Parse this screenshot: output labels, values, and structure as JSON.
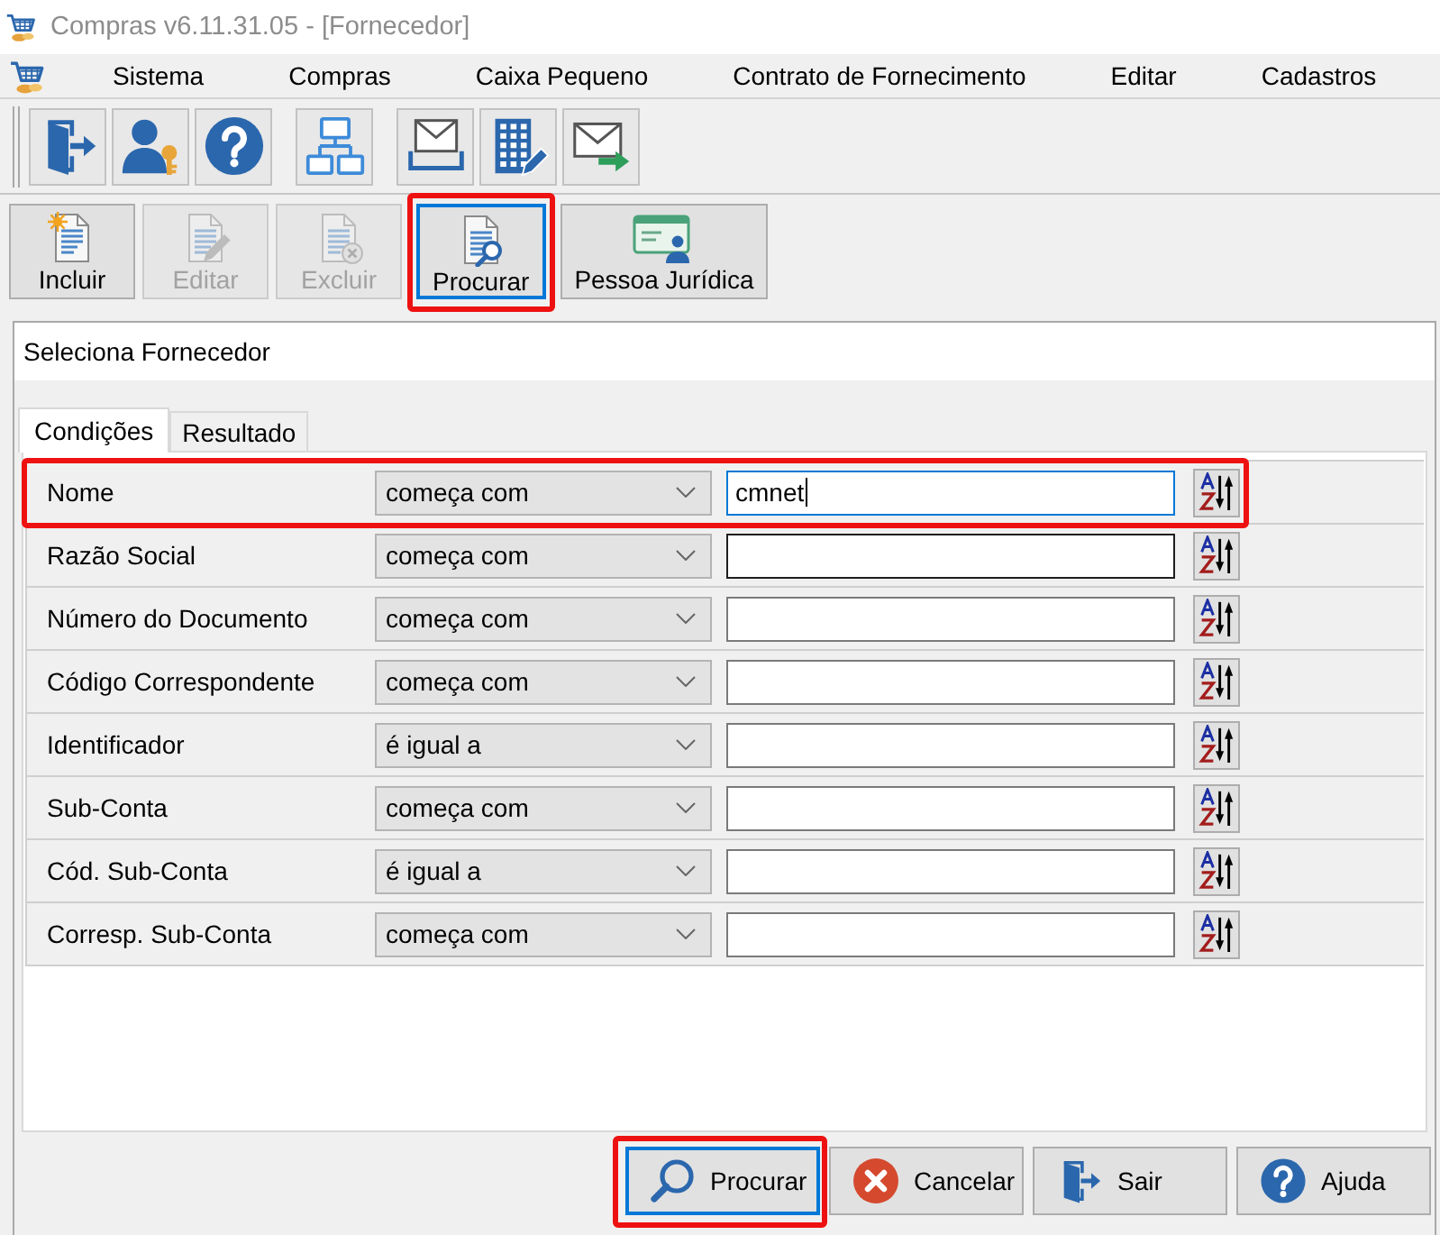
{
  "window": {
    "title": "Compras v6.11.31.05 - [Fornecedor]"
  },
  "menu": [
    "Sistema",
    "Compras",
    "Caixa Pequeno",
    "Contrato de Fornecimento",
    "Editar",
    "Cadastros"
  ],
  "toolbar": [
    {
      "label": "Incluir",
      "disabled": false,
      "focused": false,
      "highlighted": false
    },
    {
      "label": "Editar",
      "disabled": true,
      "focused": false,
      "highlighted": false
    },
    {
      "label": "Excluir",
      "disabled": true,
      "focused": false,
      "highlighted": false
    },
    {
      "label": "Procurar",
      "disabled": false,
      "focused": true,
      "highlighted": true
    },
    {
      "label": "Pessoa Jurídica",
      "disabled": false,
      "focused": false,
      "highlighted": false
    }
  ],
  "dialog": {
    "title": "Seleciona Fornecedor",
    "tabs": [
      {
        "label": "Condições",
        "selected": true
      },
      {
        "label": "Resultado",
        "selected": false
      }
    ],
    "conditions": [
      {
        "field": "Nome",
        "operator": "começa com",
        "value": "cmnet",
        "focused": true,
        "hovered": false,
        "highlighted": true
      },
      {
        "field": "Razão Social",
        "operator": "começa com",
        "focused": false,
        "hovered": true,
        "highlighted": false
      },
      {
        "field": "Número do Documento",
        "operator": "começa com",
        "focused": false,
        "hovered": false,
        "highlighted": false
      },
      {
        "field": "Código Correspondente",
        "operator": "começa com",
        "focused": false,
        "hovered": false,
        "highlighted": false
      },
      {
        "field": "Identificador",
        "operator": "é igual a",
        "focused": false,
        "hovered": false,
        "highlighted": false
      },
      {
        "field": "Sub-Conta",
        "operator": "começa com",
        "focused": false,
        "hovered": false,
        "highlighted": false
      },
      {
        "field": "Cód. Sub-Conta",
        "operator": "é igual a",
        "focused": false,
        "hovered": false,
        "highlighted": false
      },
      {
        "field": "Corresp. Sub-Conta",
        "operator": "começa com",
        "focused": false,
        "hovered": false,
        "highlighted": false
      }
    ],
    "buttons": [
      {
        "label": "Procurar",
        "focused": true,
        "highlighted": true
      },
      {
        "label": "Cancelar",
        "focused": false,
        "highlighted": false
      },
      {
        "label": "Sair",
        "focused": false,
        "highlighted": false
      },
      {
        "label": "Ajuda",
        "focused": false,
        "highlighted": false
      }
    ]
  }
}
